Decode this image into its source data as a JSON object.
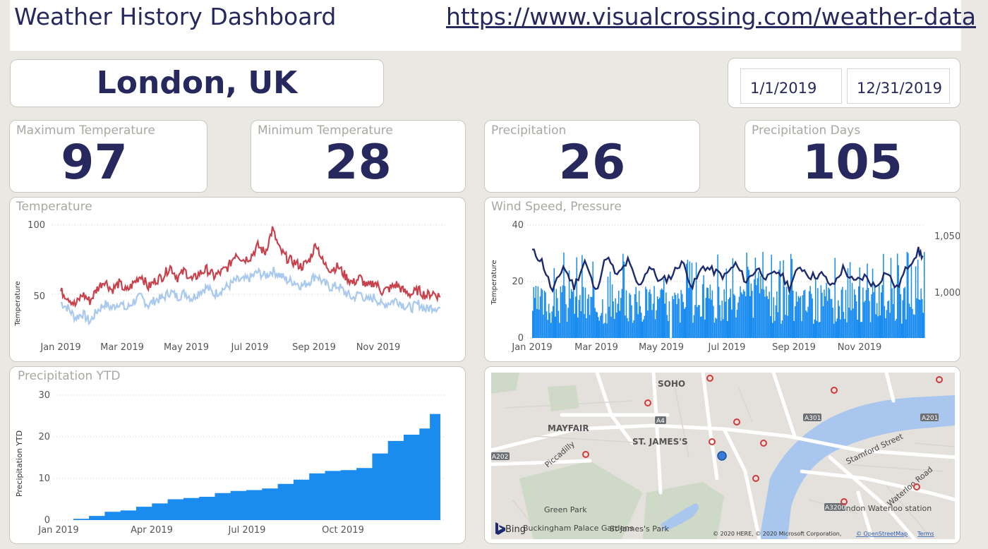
{
  "header": {
    "title": "Weather History Dashboard",
    "link": "https://www.visualcrossing.com/weather-data"
  },
  "location": {
    "city": "London, UK"
  },
  "date_range": {
    "start": "1/1/2019",
    "end": "12/31/2019"
  },
  "kpis": [
    {
      "label": "Maximum Temperature",
      "value": "97"
    },
    {
      "label": "Minimum Temperature",
      "value": "28"
    },
    {
      "label": "Precipitation",
      "value": "26"
    },
    {
      "label": "Precipitation Days",
      "value": "105"
    }
  ],
  "colors": {
    "navy": "#27285e",
    "max_temp": "#c8424e",
    "min_temp": "#a9c9ef",
    "bar_blue": "#1a8cf0",
    "pressure_line": "#1c2a6e",
    "card_border": "#c9c8c0",
    "label_gray": "#a8a8a2"
  },
  "chart_data": [
    {
      "id": "temperature",
      "type": "line",
      "title": "Temperature",
      "xlabel": "",
      "ylabel": "Temperature",
      "ylim": [
        28,
        100
      ],
      "y_ticks": [
        "100",
        "50"
      ],
      "x_ticks": [
        "Jan 2019",
        "Mar 2019",
        "May 2019",
        "Jul 2019",
        "Sep 2019",
        "Nov 2019"
      ],
      "grid": true,
      "series": [
        {
          "key": "max",
          "points": [
            [
              1,
              52
            ],
            [
              8,
              48
            ],
            [
              15,
              42
            ],
            [
              22,
              50
            ],
            [
              29,
              45
            ],
            [
              36,
              54
            ],
            [
              43,
              60
            ],
            [
              50,
              53
            ],
            [
              57,
              58
            ],
            [
              64,
              52
            ],
            [
              71,
              58
            ],
            [
              78,
              64
            ],
            [
              85,
              55
            ],
            [
              92,
              60
            ],
            [
              99,
              63
            ],
            [
              106,
              70
            ],
            [
              113,
              62
            ],
            [
              120,
              67
            ],
            [
              127,
              60
            ],
            [
              134,
              65
            ],
            [
              141,
              68
            ],
            [
              148,
              63
            ],
            [
              155,
              66
            ],
            [
              162,
              70
            ],
            [
              169,
              80
            ],
            [
              176,
              75
            ],
            [
              183,
              77
            ],
            [
              190,
              85
            ],
            [
              197,
              80
            ],
            [
              204,
              97
            ],
            [
              211,
              82
            ],
            [
              218,
              76
            ],
            [
              225,
              73
            ],
            [
              232,
              70
            ],
            [
              239,
              74
            ],
            [
              246,
              87
            ],
            [
              253,
              72
            ],
            [
              260,
              68
            ],
            [
              267,
              70
            ],
            [
              274,
              63
            ],
            [
              281,
              58
            ],
            [
              288,
              62
            ],
            [
              295,
              55
            ],
            [
              302,
              59
            ],
            [
              309,
              52
            ],
            [
              316,
              54
            ],
            [
              323,
              57
            ],
            [
              330,
              52
            ],
            [
              337,
              50
            ],
            [
              344,
              53
            ],
            [
              351,
              49
            ],
            [
              358,
              51
            ],
            [
              365,
              48
            ]
          ]
        },
        {
          "key": "min",
          "points": [
            [
              1,
              44
            ],
            [
              8,
              40
            ],
            [
              15,
              33
            ],
            [
              22,
              36
            ],
            [
              29,
              30
            ],
            [
              36,
              38
            ],
            [
              43,
              43
            ],
            [
              50,
              40
            ],
            [
              57,
              44
            ],
            [
              64,
              39
            ],
            [
              71,
              45
            ],
            [
              78,
              48
            ],
            [
              85,
              42
            ],
            [
              92,
              46
            ],
            [
              99,
              47
            ],
            [
              106,
              52
            ],
            [
              113,
              48
            ],
            [
              120,
              51
            ],
            [
              127,
              47
            ],
            [
              134,
              52
            ],
            [
              141,
              55
            ],
            [
              148,
              50
            ],
            [
              155,
              53
            ],
            [
              162,
              56
            ],
            [
              169,
              60
            ],
            [
              176,
              60
            ],
            [
              183,
              62
            ],
            [
              190,
              66
            ],
            [
              197,
              63
            ],
            [
              204,
              67
            ],
            [
              211,
              64
            ],
            [
              218,
              60
            ],
            [
              225,
              59
            ],
            [
              232,
              56
            ],
            [
              239,
              59
            ],
            [
              246,
              64
            ],
            [
              253,
              58
            ],
            [
              260,
              55
            ],
            [
              267,
              56
            ],
            [
              274,
              51
            ],
            [
              281,
              47
            ],
            [
              288,
              51
            ],
            [
              295,
              45
            ],
            [
              302,
              48
            ],
            [
              309,
              42
            ],
            [
              316,
              44
            ],
            [
              323,
              46
            ],
            [
              330,
              42
            ],
            [
              337,
              40
            ],
            [
              344,
              43
            ],
            [
              351,
              39
            ],
            [
              358,
              41
            ],
            [
              365,
              40
            ]
          ]
        }
      ]
    },
    {
      "id": "wind-pressure",
      "type": "bar",
      "title": "Wind Speed, Pressure",
      "xlabel": "",
      "ylabel": "Temperature",
      "ylim": [
        0,
        40
      ],
      "y_ticks": [
        "40",
        "20",
        "0"
      ],
      "y2_ticks": [
        "1,050",
        "1,000"
      ],
      "y2lim": [
        950,
        1060
      ],
      "x_ticks": [
        "Jan 2019",
        "Mar 2019",
        "May 2019",
        "Jul 2019",
        "Sep 2019",
        "Nov 2019"
      ],
      "grid": true,
      "series": [
        {
          "key": "pressure",
          "type": "line",
          "points": [
            [
              1,
              1035
            ],
            [
              10,
              1025
            ],
            [
              20,
              995
            ],
            [
              30,
              1020
            ],
            [
              40,
              1000
            ],
            [
              50,
              1025
            ],
            [
              60,
              995
            ],
            [
              70,
              1030
            ],
            [
              80,
              1010
            ],
            [
              90,
              1025
            ],
            [
              100,
              1000
            ],
            [
              110,
              1020
            ],
            [
              120,
              1005
            ],
            [
              130,
              1010
            ],
            [
              140,
              1025
            ],
            [
              150,
              1000
            ],
            [
              160,
              1020
            ],
            [
              170,
              1015
            ],
            [
              180,
              1010
            ],
            [
              190,
              1022
            ],
            [
              200,
              1005
            ],
            [
              210,
              1018
            ],
            [
              220,
              1008
            ],
            [
              230,
              1015
            ],
            [
              240,
              1000
            ],
            [
              250,
              1020
            ],
            [
              260,
              1010
            ],
            [
              270,
              1012
            ],
            [
              280,
              1000
            ],
            [
              290,
              1018
            ],
            [
              300,
              1004
            ],
            [
              310,
              1010
            ],
            [
              320,
              1000
            ],
            [
              330,
              1015
            ],
            [
              340,
              998
            ],
            [
              350,
              1020
            ],
            [
              360,
              1035
            ],
            [
              365,
              1028
            ]
          ]
        },
        {
          "key": "wind_speed",
          "type": "bar",
          "values_note": "daily bars 5-32"
        }
      ]
    },
    {
      "id": "precip-ytd",
      "type": "area",
      "title": "Precipitation YTD",
      "xlabel": "",
      "ylabel": "Precipitation YTD",
      "ylim": [
        0,
        30
      ],
      "y_ticks": [
        "30",
        "20",
        "10",
        "0"
      ],
      "x_ticks": [
        "Jan 2019",
        "Apr 2019",
        "Jul 2019",
        "Oct 2019"
      ],
      "grid": true,
      "series": [
        {
          "key": "ytd",
          "points": [
            [
              1,
              0
            ],
            [
              15,
              0.3
            ],
            [
              30,
              1
            ],
            [
              45,
              2
            ],
            [
              60,
              2.3
            ],
            [
              75,
              3.2
            ],
            [
              90,
              4
            ],
            [
              105,
              5
            ],
            [
              120,
              5.3
            ],
            [
              135,
              5.6
            ],
            [
              150,
              6.5
            ],
            [
              165,
              7
            ],
            [
              180,
              7.2
            ],
            [
              195,
              7.6
            ],
            [
              210,
              8.7
            ],
            [
              225,
              9.7
            ],
            [
              240,
              11.2
            ],
            [
              255,
              11.8
            ],
            [
              270,
              12
            ],
            [
              285,
              12.5
            ],
            [
              300,
              16
            ],
            [
              315,
              19
            ],
            [
              330,
              20.5
            ],
            [
              345,
              22
            ],
            [
              355,
              25.5
            ],
            [
              365,
              26
            ]
          ]
        }
      ]
    }
  ],
  "map": {
    "labels": [
      "SOHO",
      "MAYFAIR",
      "ST. JAMES'S",
      "Green Park",
      "Buckingham Palace Gardens",
      "St James's Park",
      "Piccadilly",
      "Stamford Street",
      "Waterloo Road",
      "London Waterloo station"
    ],
    "road_badges": [
      "A4",
      "A301",
      "A201",
      "A202",
      "A3200"
    ],
    "attribution": "© 2020 HERE, © 2020 Microsoft Corporation,",
    "osm_link": "© OpenStreetMap",
    "terms_link": "Terms",
    "bing": "Bing"
  }
}
